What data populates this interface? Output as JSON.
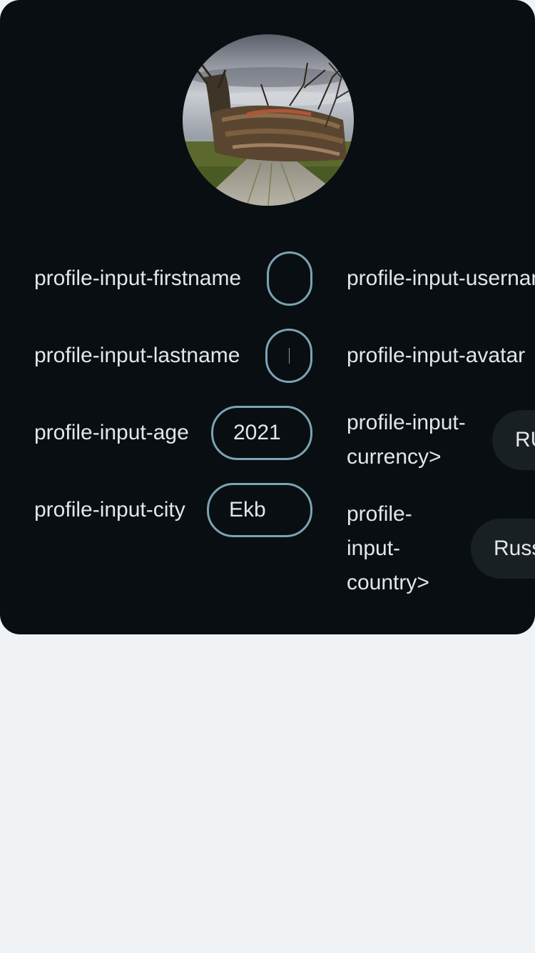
{
  "form": {
    "firstname": {
      "label": "profile-input-firstname",
      "value": ""
    },
    "lastname": {
      "label": "profile-input-lastname",
      "value": ""
    },
    "age": {
      "label": "profile-input-age",
      "value": "2021"
    },
    "city": {
      "label": "profile-input-city",
      "value": "Ekb"
    },
    "username": {
      "label": "profile-input-username"
    },
    "avatar": {
      "label": "profile-input-avatar"
    },
    "currency": {
      "label": "profile-input-currency>",
      "value": "RUB"
    },
    "country": {
      "label": "profile-input-country>",
      "value": "Russia"
    }
  }
}
